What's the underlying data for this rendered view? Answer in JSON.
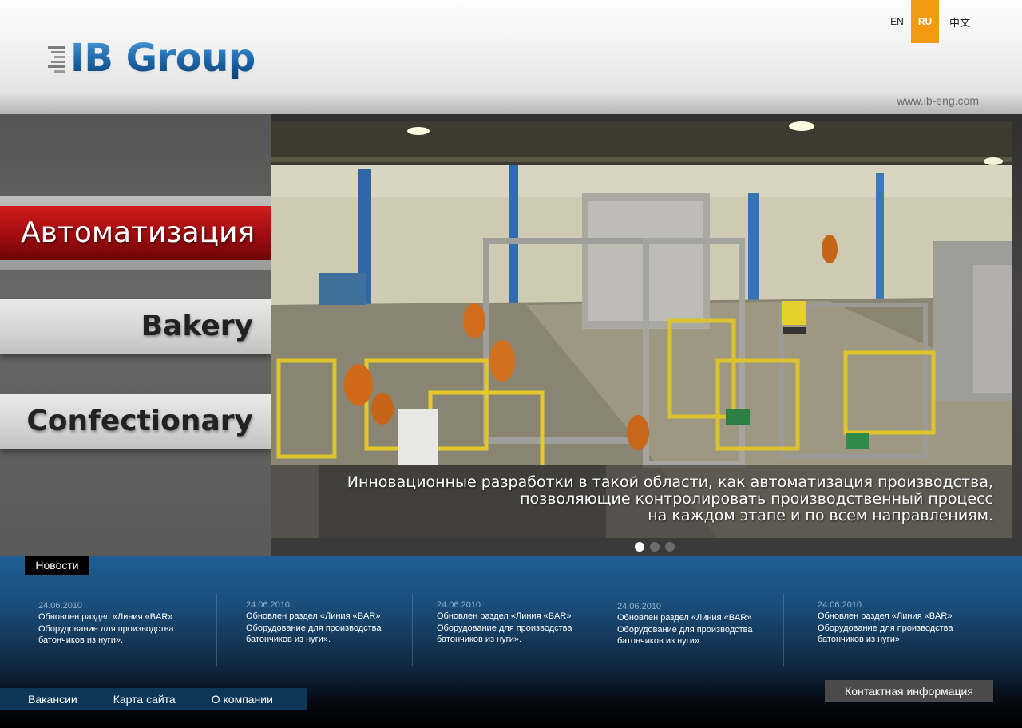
{
  "brand": {
    "name": "IB Group",
    "logo_icon": "stacked-lines-icon"
  },
  "languages": [
    {
      "code": "EN",
      "active": false
    },
    {
      "code": "RU",
      "active": true
    },
    {
      "code": "中文",
      "active": false
    }
  ],
  "site_url": "www.ib-eng.com",
  "nav": {
    "active_label": "Автоматизация",
    "bakery_label": "Bakery",
    "confectionary_label": "Confectionary"
  },
  "hero": {
    "caption": "Инновационные разработки в такой области, как автоматизация производства,\nпозволяющие контролировать производственный процесс\nна каждом этапе и по всем направлениям.",
    "slide_count": 3,
    "active_slide": 1
  },
  "news": {
    "tab_label": "Новости",
    "items": [
      {
        "date": "24.06.2010",
        "text": "Обновлен раздел «Линия «BAR»\nОборудование для производства\nбатончиков из нуги»."
      },
      {
        "date": "24.06.2010",
        "text": "Обновлен раздел «Линия «BAR»\nОборудование для производства\nбатончиков из нуги»."
      },
      {
        "date": "24.06.2010",
        "text": "Обновлен раздел «Линия «BAR»\nОборудование для производства\nбатончиков из нуги»."
      },
      {
        "date": "24.06.2010",
        "text": "Обновлен раздел «Линия «BAR»\nОборудование для производства\nбатончиков из нуги»."
      },
      {
        "date": "24.06.2010",
        "text": "Обновлен раздел «Линия «BAR»\nОборудование для производства\nбатончиков из нуги»."
      }
    ]
  },
  "footer": {
    "links": [
      "Вакансии",
      "Карта сайта",
      "О компании"
    ],
    "contact_label": "Контактная информация"
  },
  "colors": {
    "accent_orange": "#f39a12",
    "active_nav_red": "#a50d10",
    "news_blue": "#1f5f95",
    "logo_blue": "#1e6fb3"
  }
}
